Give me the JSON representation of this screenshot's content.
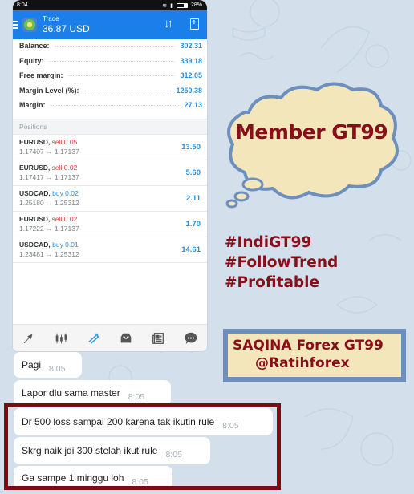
{
  "status_bar": {
    "time": "8:04",
    "battery": "28%"
  },
  "app_bar": {
    "title": "Trade",
    "balance_display": "36.87 USD",
    "icons": [
      "menu-icon",
      "metatrader-logo",
      "sort-icon",
      "new-order-icon"
    ]
  },
  "summary": [
    {
      "label": "Balance:",
      "value": "302.31"
    },
    {
      "label": "Equity:",
      "value": "339.18"
    },
    {
      "label": "Free margin:",
      "value": "312.05"
    },
    {
      "label": "Margin Level (%):",
      "value": "1250.38"
    },
    {
      "label": "Margin:",
      "value": "27.13"
    }
  ],
  "positions": {
    "header": "Positions",
    "items": [
      {
        "symbol": "EURUSD,",
        "direction": "sell 0.05",
        "type": "sell",
        "prices": "1.17407 → 1.17137",
        "profit": "13.50"
      },
      {
        "symbol": "EURUSD,",
        "direction": "sell 0.02",
        "type": "sell",
        "prices": "1.17417 → 1.17137",
        "profit": "5.60"
      },
      {
        "symbol": "USDCAD,",
        "direction": "buy 0.02",
        "type": "buy",
        "prices": "1.25180 → 1.25312",
        "profit": "2.11"
      },
      {
        "symbol": "EURUSD,",
        "direction": "sell 0.02",
        "type": "sell",
        "prices": "1.17222 → 1.17137",
        "profit": "1.70"
      },
      {
        "symbol": "USDCAD,",
        "direction": "buy 0.01",
        "type": "buy",
        "prices": "1.23481 → 1.25312",
        "profit": "14.61"
      }
    ]
  },
  "tab_bar": [
    "quotes-icon",
    "charts-icon",
    "trade-icon",
    "history-icon",
    "news-icon",
    "chat-icon"
  ],
  "chat_messages": [
    {
      "text": "Pagi",
      "time": "8:05"
    },
    {
      "text": "Lapor dlu sama master",
      "time": "8:05"
    },
    {
      "text": "Dr 500 loss sampai 200 karena tak ikutin rule",
      "time": "8:05"
    },
    {
      "text": "Skrg naik jdi 300 stelah ikut rule",
      "time": "8:05"
    },
    {
      "text": "Ga sampe 1 minggu loh",
      "time": "8:05"
    }
  ],
  "overlay": {
    "cloud_text": "Member GT99",
    "hashtags": [
      "#IndiGT99",
      "#FollowTrend",
      "#Profitable"
    ],
    "signature_line1": "SAQINA Forex GT99",
    "signature_line2": "@Ratihforex"
  },
  "colors": {
    "accent_blue": "#1a7fe8",
    "value_blue": "#2f8ed3",
    "sell_red": "#d9383e",
    "brand_maroon": "#8a0d1a",
    "cloud_fill": "#f4e6bb",
    "cloud_stroke": "#6d8fbe",
    "chat_bg": "#d3e0eb"
  }
}
